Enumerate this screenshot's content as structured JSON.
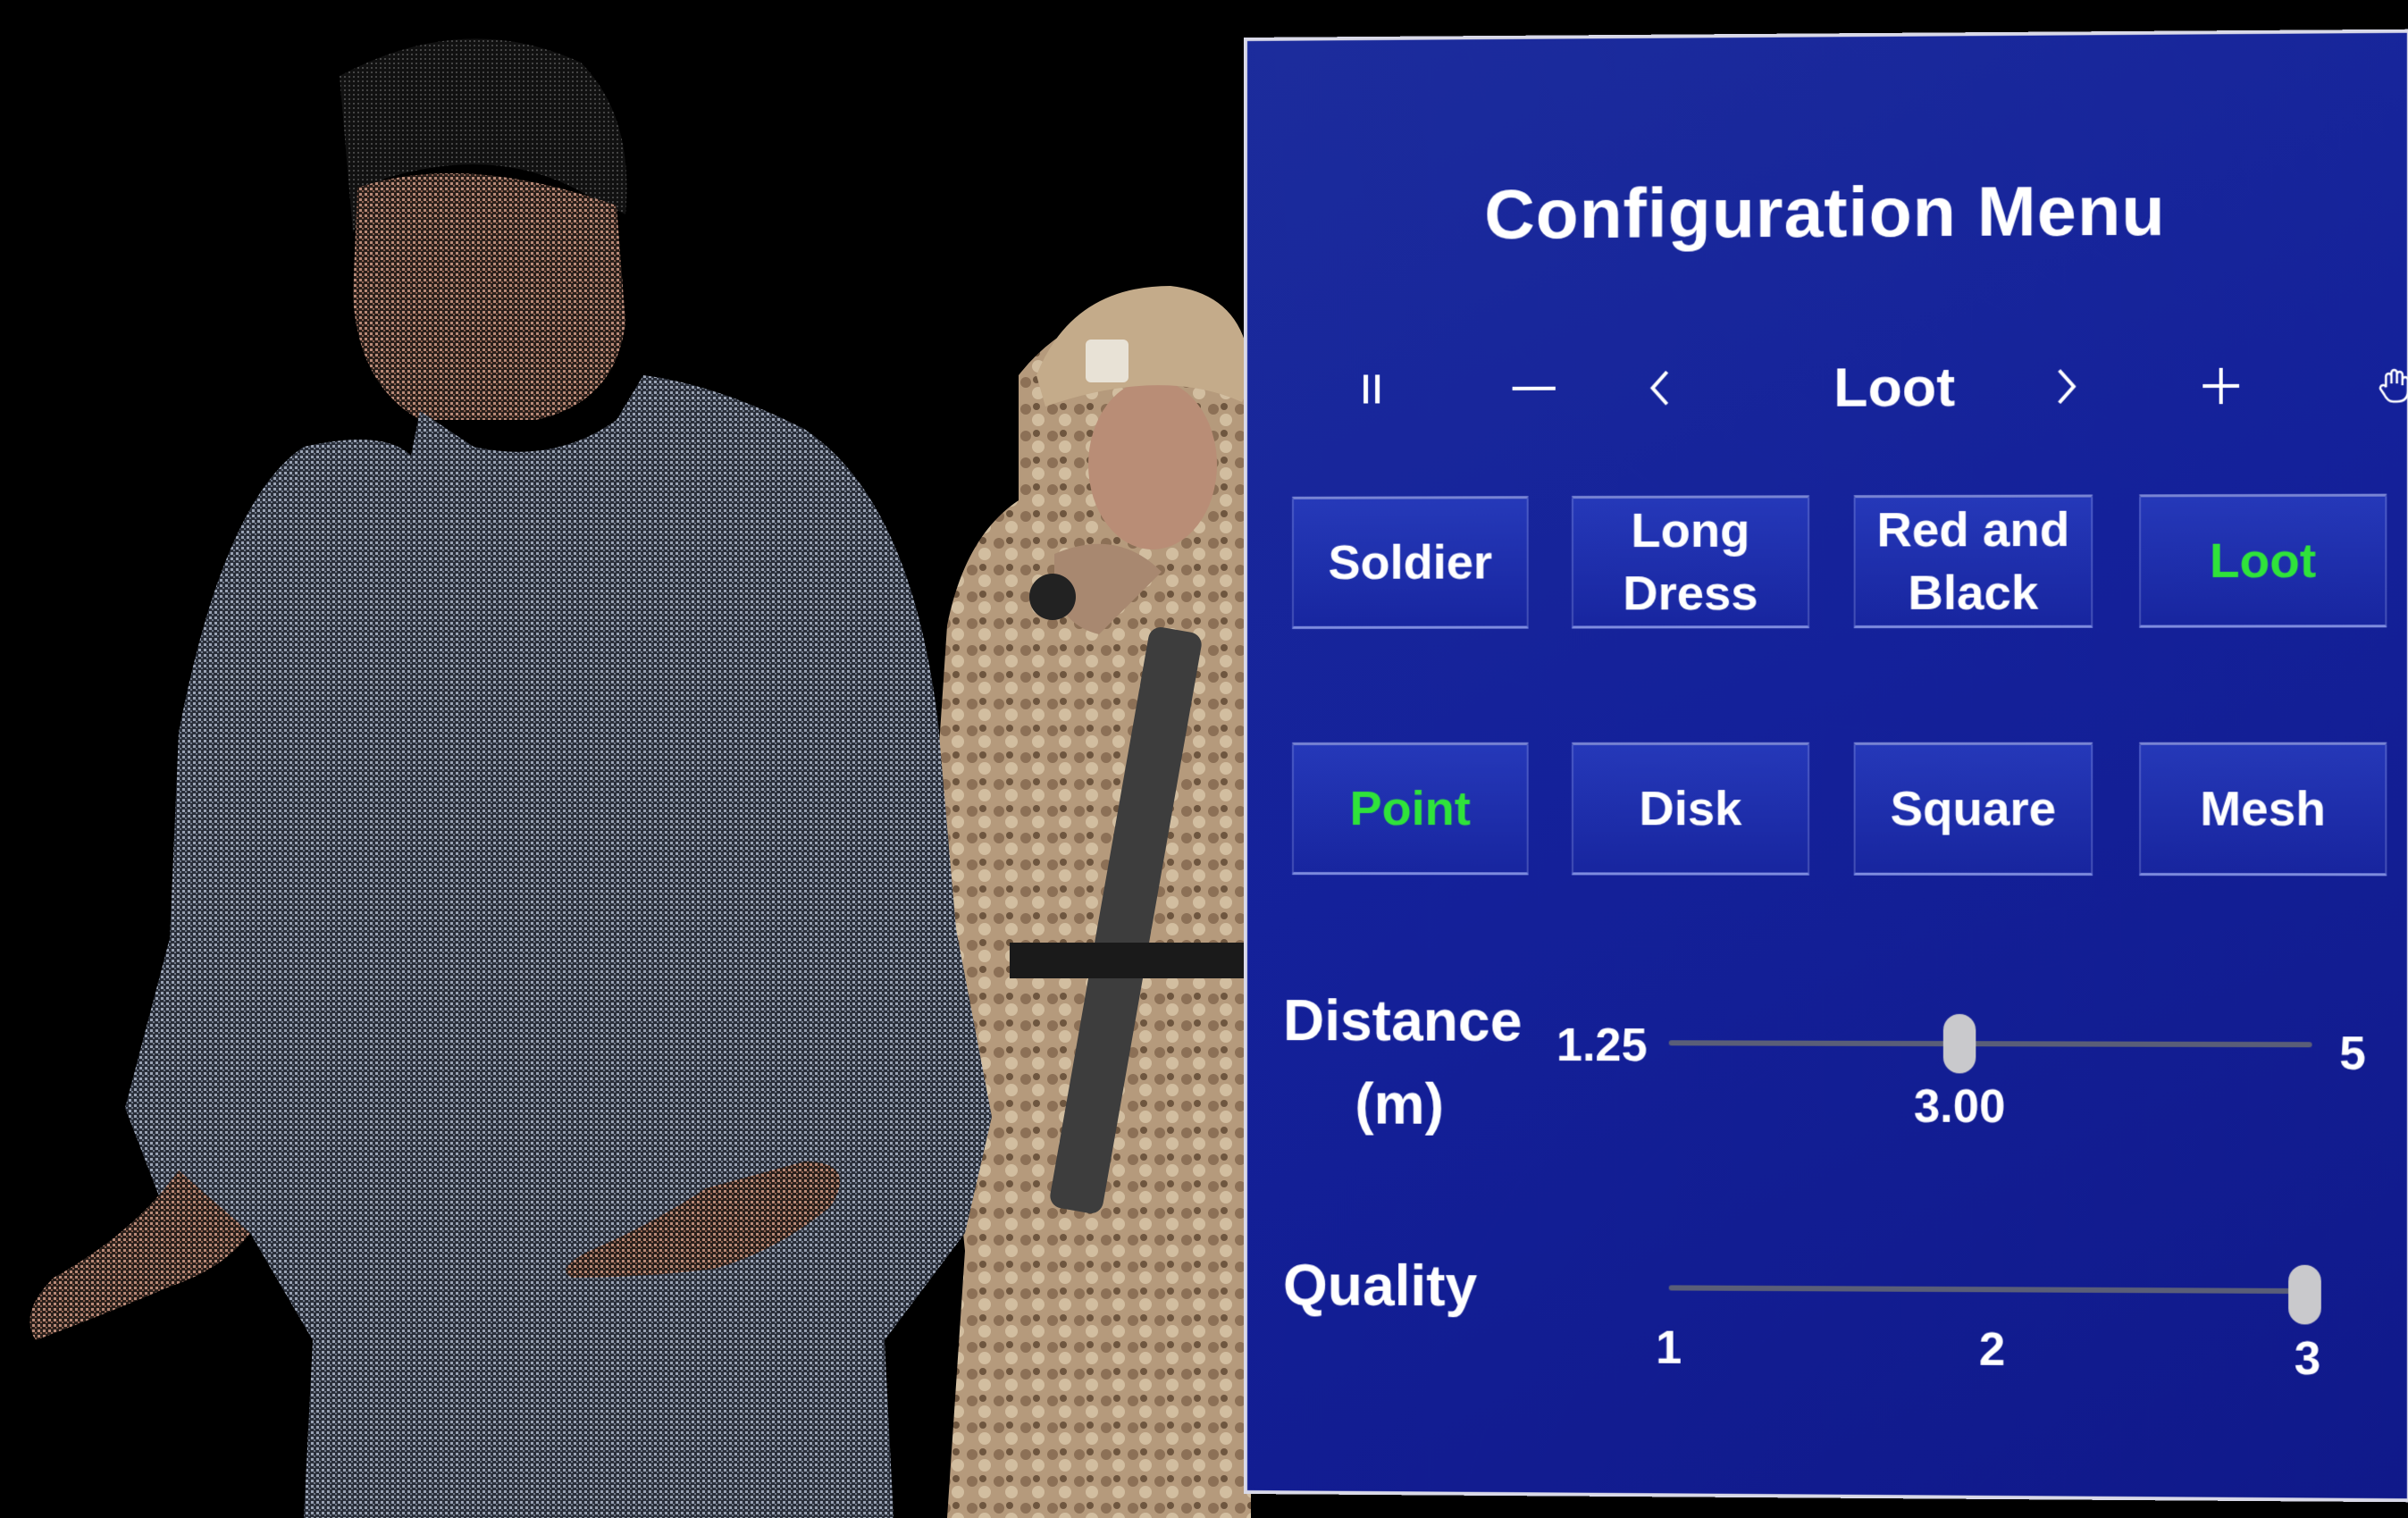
{
  "panel": {
    "title": "Configuration Menu",
    "toolbar": {
      "current_model": "Loot",
      "icons": [
        "pause-icon",
        "minus-icon",
        "chevron-left-icon",
        "chevron-right-icon",
        "plus-icon",
        "hand-icon"
      ]
    },
    "models": [
      {
        "label_line1": "Soldier",
        "label_line2": "",
        "selected": false
      },
      {
        "label_line1": "Long",
        "label_line2": "Dress",
        "selected": false
      },
      {
        "label_line1": "Red and",
        "label_line2": "Black",
        "selected": false
      },
      {
        "label_line1": "Loot",
        "label_line2": "",
        "selected": true
      }
    ],
    "render_modes": [
      {
        "label": "Point",
        "selected": true
      },
      {
        "label": "Disk",
        "selected": false
      },
      {
        "label": "Square",
        "selected": false
      },
      {
        "label": "Mesh",
        "selected": false
      }
    ],
    "distance": {
      "label_line1": "Distance",
      "label_line2": "(m)",
      "min": "1.25",
      "max": "5",
      "value": "3.00"
    },
    "quality": {
      "label": "Quality",
      "ticks": [
        "1",
        "2",
        "3"
      ],
      "value": 3
    }
  },
  "colors": {
    "panel_bg": "#14219a",
    "selected_text": "#2fe33a",
    "text": "#ffffff"
  }
}
